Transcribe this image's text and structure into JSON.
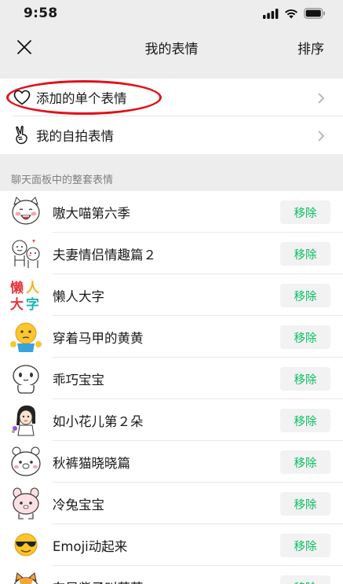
{
  "status_bar": {
    "time": "9:58"
  },
  "nav": {
    "title": "我的表情",
    "sort_label": "排序"
  },
  "top_group": [
    {
      "label": "添加的单个表情",
      "icon": "heart-outline-icon"
    },
    {
      "label": "我的自拍表情",
      "icon": "peace-hand-icon"
    }
  ],
  "section_header": "聊天面板中的整套表情",
  "packs": [
    {
      "name": "嗷大喵第六季",
      "remove": "移除"
    },
    {
      "name": "夫妻情侣情趣篇２",
      "remove": "移除"
    },
    {
      "name": "懒人大字",
      "remove": "移除",
      "thumb_chars": [
        "懒",
        "人",
        "大",
        "字"
      ]
    },
    {
      "name": "穿着马甲的黄黄",
      "remove": "移除"
    },
    {
      "name": "乖巧宝宝",
      "remove": "移除"
    },
    {
      "name": "如小花儿第２朵",
      "remove": "移除"
    },
    {
      "name": "秋裤猫晓晓篇",
      "remove": "移除"
    },
    {
      "name": "冷兔宝宝",
      "remove": "移除"
    },
    {
      "name": "Emoji动起来",
      "remove": "移除"
    },
    {
      "name": "东凤紫子叫萌萌",
      "remove": "移除"
    }
  ],
  "colors": {
    "accent_green": "#07c160",
    "highlight_red": "#e3101a"
  }
}
